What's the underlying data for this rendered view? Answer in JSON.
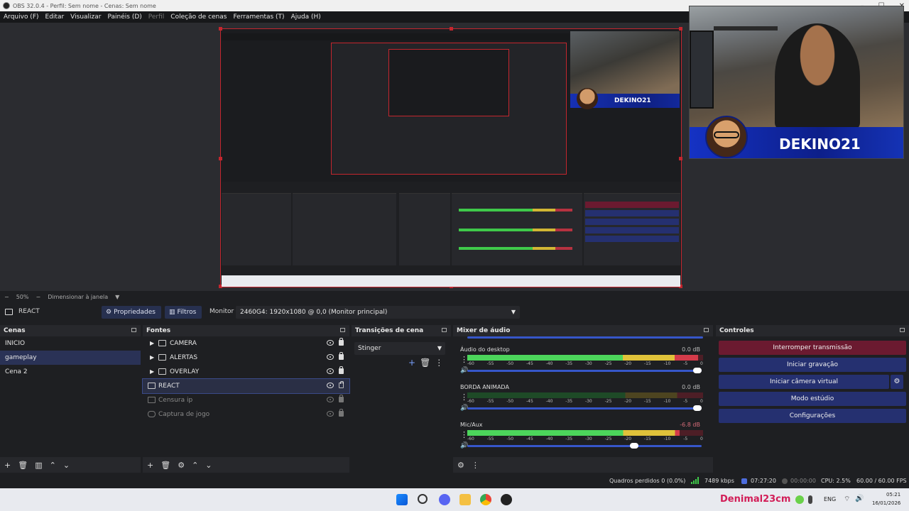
{
  "window": {
    "title": "OBS 32.0.4 - Perfil: Sem nome - Cenas: Sem nome"
  },
  "menu": [
    "Arquivo (F)",
    "Editar",
    "Visualizar",
    "Painéis (D)",
    "Perfil",
    "Coleção de cenas",
    "Ferramentas (T)",
    "Ajuda (H)"
  ],
  "overlay": {
    "brand_text": "DEKINO21"
  },
  "zoom": {
    "value": "50%",
    "fit_label": "Dimensionar à janela"
  },
  "source_toolbar": {
    "selected_source": "REACT",
    "properties_label": "Propriedades",
    "filters_label": "Filtros",
    "monitor_label": "Monitor",
    "monitor_value": "2460G4: 1920x1080 @ 0,0 (Monitor principal)"
  },
  "scenes": {
    "title": "Cenas",
    "items": [
      {
        "label": "INICIO",
        "selected": false
      },
      {
        "label": "gameplay",
        "selected": true
      },
      {
        "label": "Cena 2",
        "selected": false
      }
    ]
  },
  "sources": {
    "title": "Fontes",
    "items": [
      {
        "label": "CAMERA",
        "type": "folder",
        "visible": true,
        "locked": true
      },
      {
        "label": "ALERTAS",
        "type": "folder",
        "visible": true,
        "locked": true
      },
      {
        "label": "OVERLAY",
        "type": "folder",
        "visible": true,
        "locked": true
      },
      {
        "label": "REACT",
        "type": "monitor",
        "visible": true,
        "locked": false
      },
      {
        "label": "Censura ip",
        "type": "image",
        "visible": false,
        "locked": true
      },
      {
        "label": "Captura de jogo",
        "type": "game",
        "visible": false,
        "locked": true
      }
    ]
  },
  "transitions": {
    "title": "Transições de cena",
    "selected": "Stinger"
  },
  "mixer": {
    "title": "Mixer de áudio",
    "scale": [
      "-60",
      "-55",
      "-50",
      "-45",
      "-40",
      "-35",
      "-30",
      "-25",
      "-20",
      "-15",
      "-10",
      "-5",
      "0"
    ],
    "channels": [
      {
        "name": "Áudio do desktop",
        "db": "0.0 dB",
        "level": 0.98,
        "volume": 1.0
      },
      {
        "name": "BORDA ANIMADA",
        "db": "0.0 dB",
        "level": 0.0,
        "volume": 1.0
      },
      {
        "name": "Mic/Aux",
        "db": "-6.8 dB",
        "level": 0.9,
        "volume": 0.73
      }
    ]
  },
  "controls": {
    "title": "Controles",
    "stop_stream": "Interromper transmissão",
    "start_record": "Iniciar gravação",
    "start_virtualcam": "Iniciar câmera virtual",
    "studio_mode": "Modo estúdio",
    "settings": "Configurações"
  },
  "status": {
    "dropped_frames": "Quadros perdidos 0 (0.0%)",
    "bitrate": "7489 kbps",
    "stream_time": "07:27:20",
    "record_time": "00:00:00",
    "cpu": "CPU: 2.5%",
    "fps": "60.00 / 60.00 FPS"
  },
  "taskbar": {
    "brand": "Denimal23cm",
    "language": "ENG",
    "time": "05:21",
    "date": "16/01/2026"
  },
  "colors": {
    "accent_blue": "#253070",
    "stop_red": "#6b1a30",
    "overlay_blue": "#1532c4",
    "taskbar_brand": "#d21d57"
  }
}
